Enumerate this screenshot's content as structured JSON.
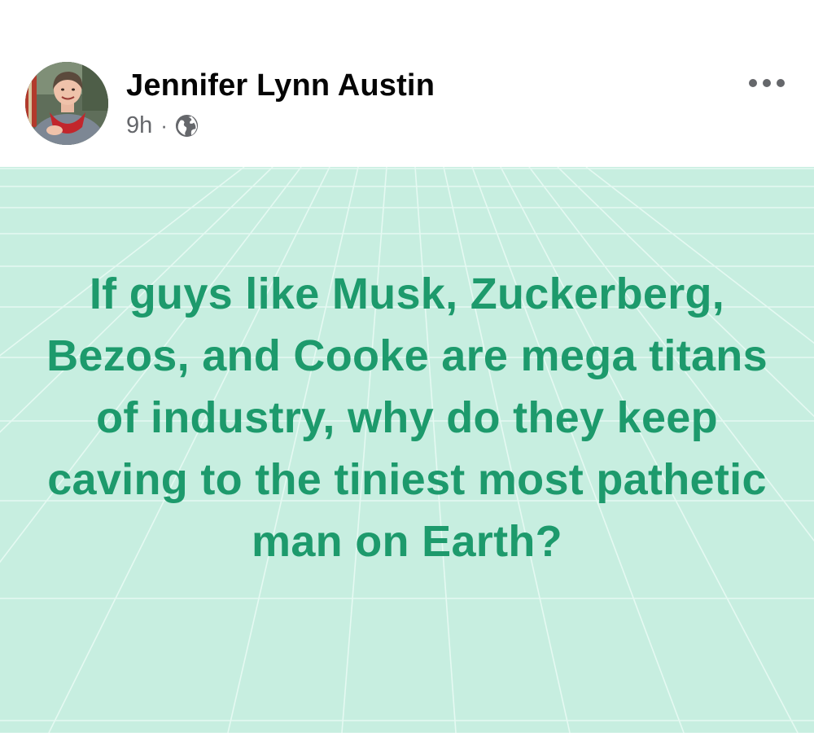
{
  "post": {
    "author": {
      "name": "Jennifer Lynn Austin",
      "avatar_icon": "profile-photo"
    },
    "meta": {
      "time": "9h",
      "separator": "·",
      "audience_icon": "globe-icon"
    },
    "more_icon": "more-options-icon",
    "status": {
      "text": "If guys like Musk, Zuckerberg, Bezos, and Cooke are mega titans of industry, why do they keep caving to the tiniest most pathetic man on Earth?",
      "background_color": "#c7eee0",
      "text_color": "#1d9a6c"
    }
  }
}
